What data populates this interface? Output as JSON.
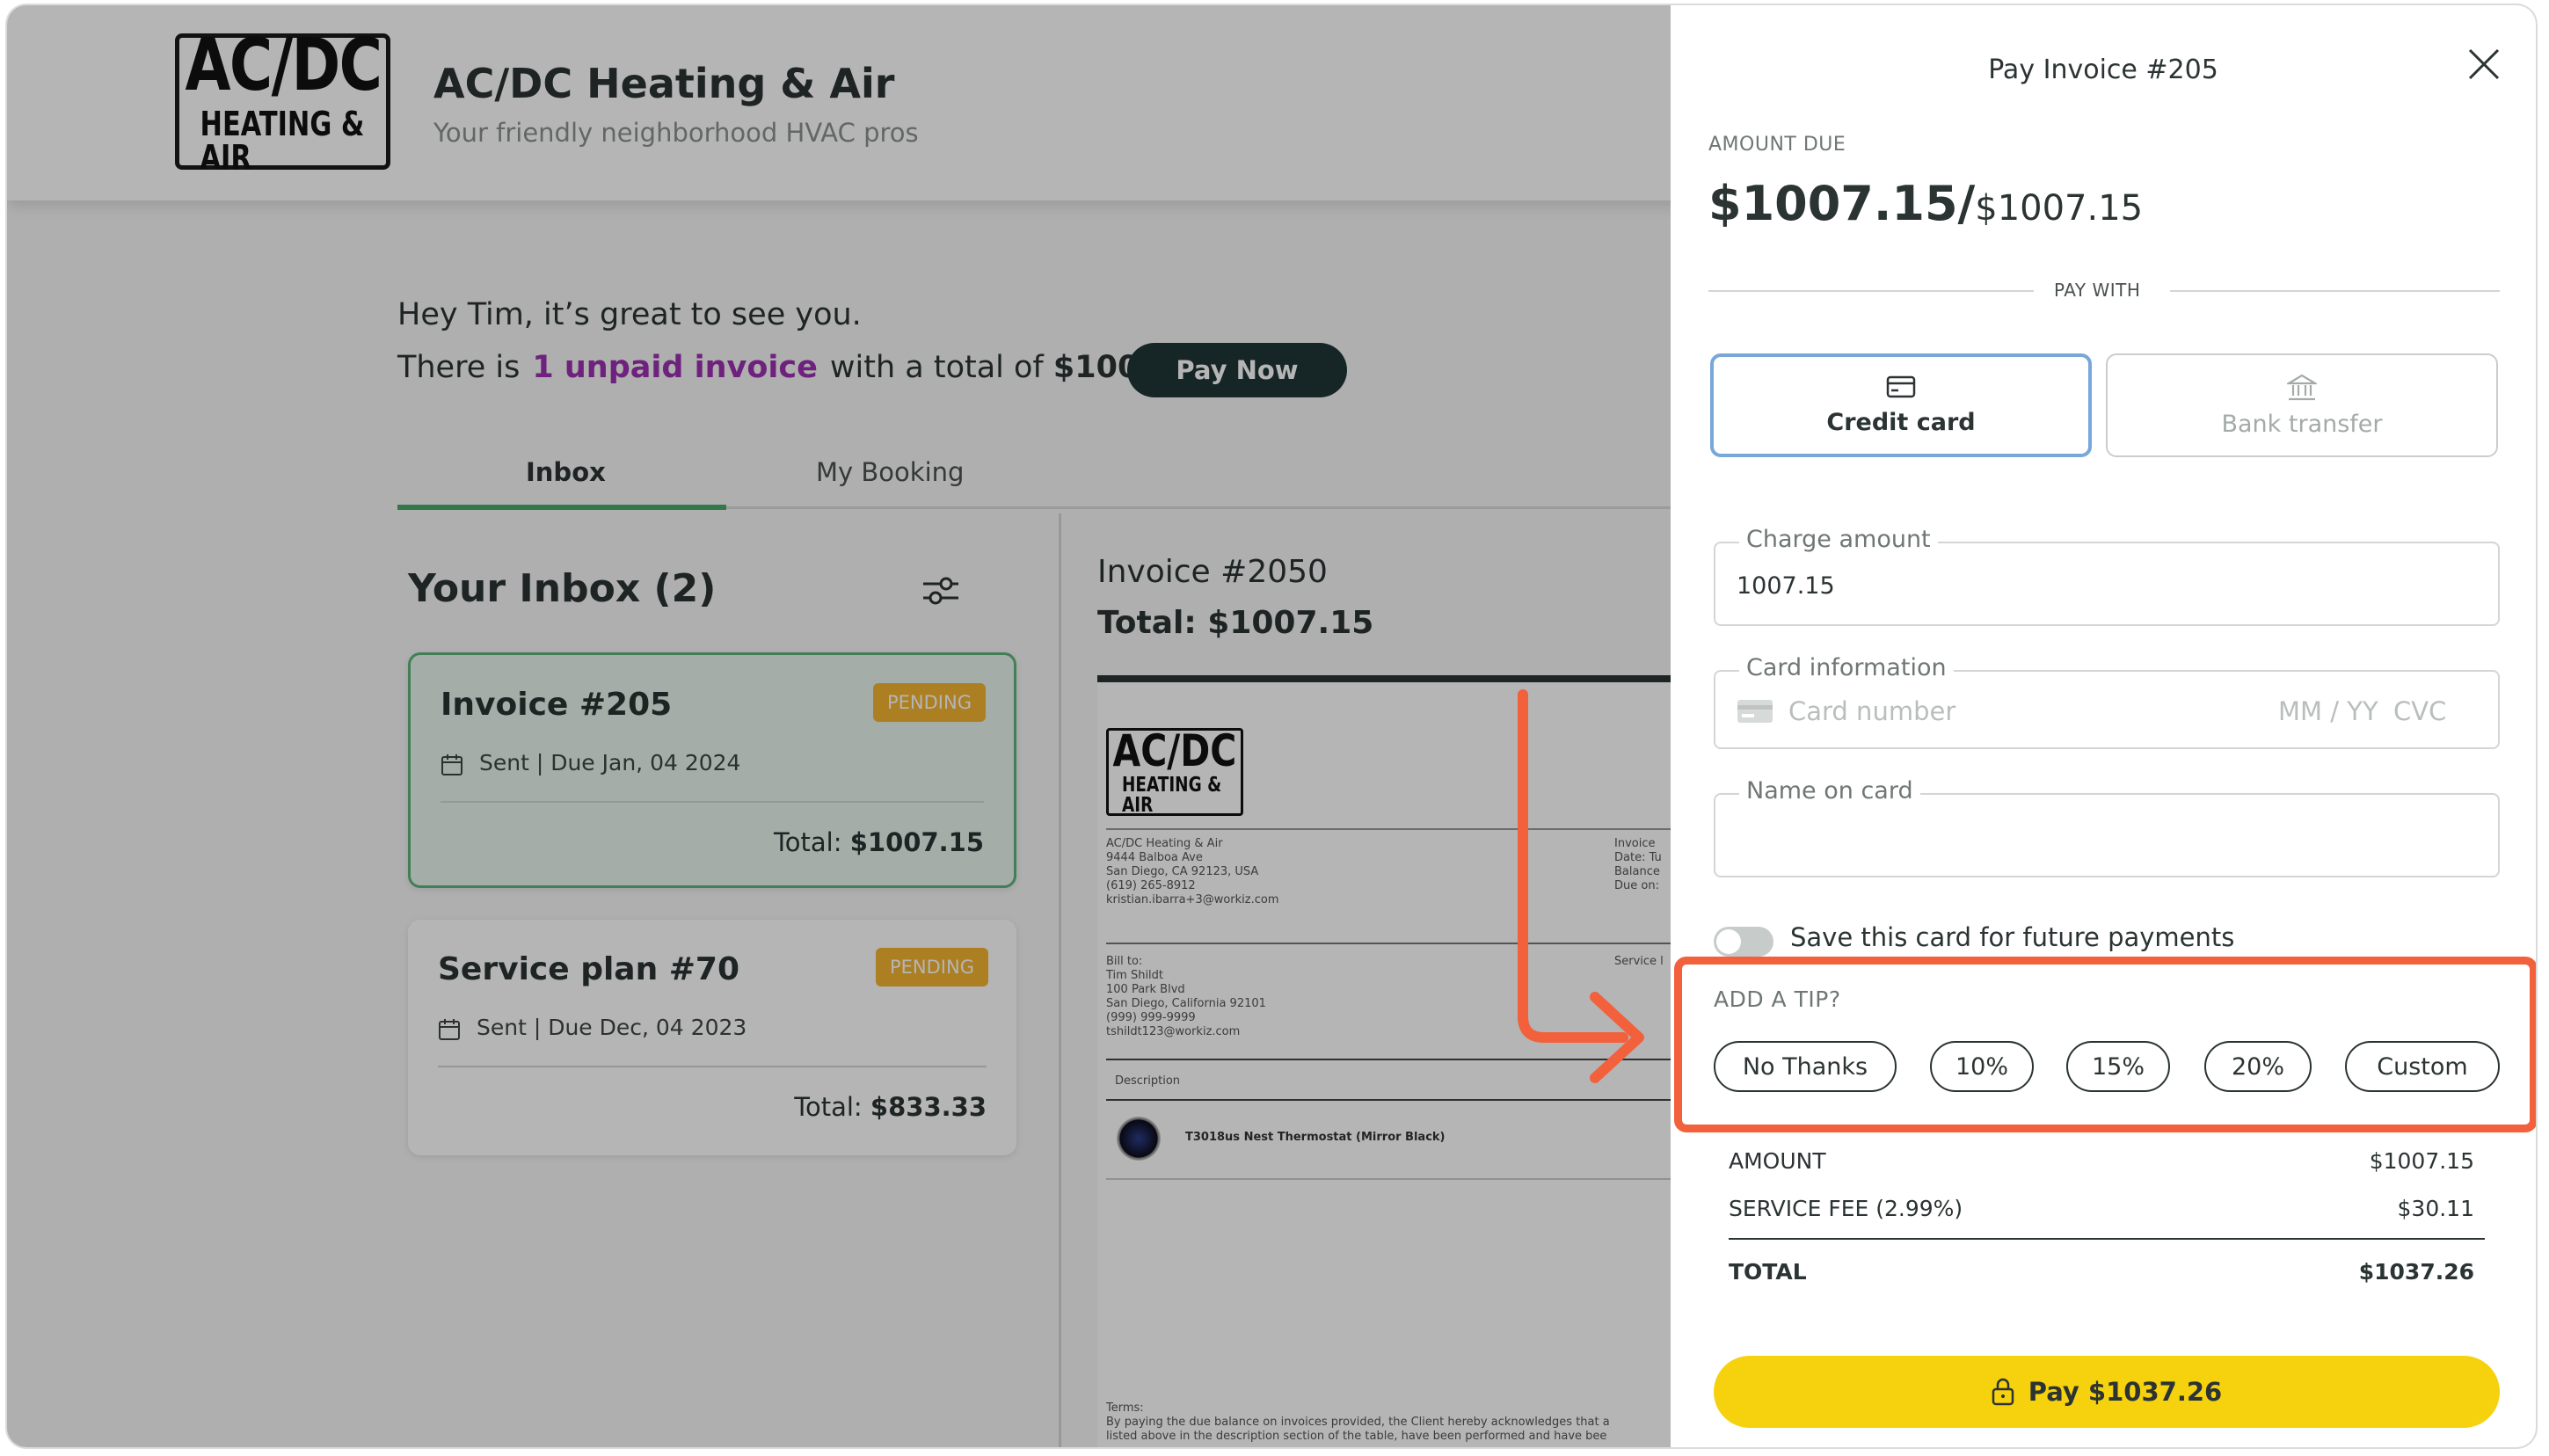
{
  "brand": {
    "logo_line1": "AC/DC",
    "logo_line2": "HEATING & AIR",
    "name": "AC/DC Heating & Air",
    "tagline": "Your friendly neighborhood HVAC pros"
  },
  "greeting": {
    "hello": "Hey Tim, it’s great to see you.",
    "prefix": "There is",
    "link": "1 unpaid invoice",
    "suffix": "with a total of",
    "total": "$1007.15",
    "pay_now": "Pay Now"
  },
  "tabs": [
    {
      "label": "Inbox",
      "active": true
    },
    {
      "label": "My Booking",
      "active": false
    }
  ],
  "inbox": {
    "title": "Your Inbox (2)",
    "items": [
      {
        "title": "Invoice #205",
        "badge": "PENDING",
        "meta": "Sent | Due Jan, 04 2024",
        "total_label": "Total:",
        "total": "$1007.15"
      },
      {
        "title": "Service plan #70",
        "badge": "PENDING",
        "meta": "Sent | Due Dec, 04 2023",
        "total_label": "Total:",
        "total": "$833.33"
      }
    ]
  },
  "invoice_preview": {
    "heading": "Invoice #2050",
    "total": "Total: $1007.15",
    "from": "AC/DC Heating & Air\n9444 Balboa Ave\nSan Diego, CA 92123, USA\n(619) 265-8912\nkristian.ibarra+3@workiz.com",
    "meta_right": "Invoice\nDate: Tu\nBalance\nDue on:",
    "bill_to": "Bill to:\nTim Shildt\n100 Park Blvd\nSan Diego, California 92101\n(999) 999-9999\ntshildt123@workiz.com",
    "service_label": "Service l",
    "description_header": "Description",
    "item": "T3018us Nest Thermostat (Mirror Black)",
    "terms": "Terms:\nBy paying the due balance on invoices provided, the Client hereby acknowledges that a\nlisted above in the description section of the table, have been performed and have bee"
  },
  "payment": {
    "title": "Pay Invoice #205",
    "amount_due_label": "AMOUNT DUE",
    "amount_paid": "$1007.15/",
    "amount_total": "$1007.15",
    "pay_with_label": "PAY WITH",
    "methods": [
      {
        "label": "Credit card",
        "selected": true,
        "icon": "credit-card-icon"
      },
      {
        "label": "Bank transfer",
        "selected": false,
        "icon": "bank-icon"
      }
    ],
    "charge_amount_label": "Charge amount",
    "charge_amount_value": "1007.15",
    "card_info_label": "Card information",
    "card_number_placeholder": "Card number",
    "expiry_placeholder": "MM / YY",
    "cvc_placeholder": "CVC",
    "name_on_card_label": "Name on card",
    "save_card_label": "Save this card for future payments",
    "save_card_enabled": false,
    "tip_title": "ADD A TIP?",
    "tip_options": [
      "No Thanks",
      "10%",
      "15%",
      "20%",
      "Custom"
    ],
    "summary": [
      {
        "label": "AMOUNT",
        "value": "$1007.15"
      },
      {
        "label": "SERVICE FEE (2.99%)",
        "value": "$30.11"
      }
    ],
    "total_label": "TOTAL",
    "total_value": "$1037.26",
    "pay_button": "Pay $1037.26"
  },
  "colors": {
    "accent_green": "#4aa868",
    "link_purple": "#9b2fb0",
    "badge_pending": "#f2b431",
    "highlight_orange": "#f2603c",
    "pay_yellow": "#f6d10e",
    "selected_blue": "#78a7d8"
  }
}
